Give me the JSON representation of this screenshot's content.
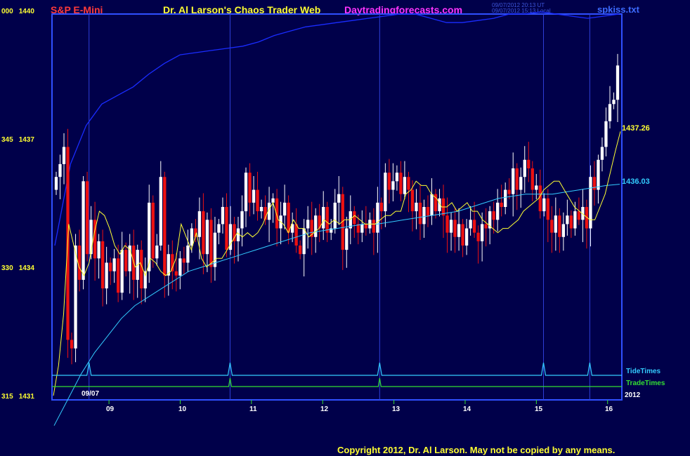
{
  "header": {
    "instrument": "S&P E-Mini",
    "title": "Dr. Al Larson's Chaos Trader Web",
    "site": "Daytradingforecasts.com",
    "file": "spkiss.txt",
    "timestamp_ut": "09/07/2012 20:13 UT",
    "timestamp_local": "09/07/2012 15:13 Local"
  },
  "footer": {
    "copyright": "Copyright 2012, Dr. Al Larson. May not be copied by any means."
  },
  "colors": {
    "background": "#00004a",
    "frame": "#3050ff",
    "up_bar": "#ffffff",
    "down_bar": "#ee1111",
    "fast_ma": "#ffff33",
    "slow_ma": "#33ccff",
    "upper_curve": "#1a2cff",
    "tide_times": "#33ccff",
    "trade_times": "#33dd33",
    "grid": "#2f3fd8"
  },
  "chart_data": {
    "type": "candlestick",
    "title": "S&P E-Mini",
    "ylim": [
      1431,
      1440
    ],
    "y_ticks": [
      {
        "left": "315",
        "value": "1431"
      },
      {
        "left": "330",
        "value": "1434"
      },
      {
        "left": "345",
        "value": "1437"
      },
      {
        "left": "000",
        "value": "1440"
      }
    ],
    "x_ticks": [
      "09",
      "10",
      "11",
      "12",
      "13",
      "14",
      "15",
      "16"
    ],
    "date_label": "09/07",
    "year_label": "2012",
    "xlim_hours": [
      8.2,
      16.2
    ],
    "vertical_time_lines": [
      8.72,
      10.7,
      12.8,
      15.1,
      15.75
    ],
    "last_values": {
      "fast_ma": "1437.26",
      "slow_ma": "1436.03"
    },
    "indicator_labels": {
      "tide": "TideTimes",
      "trade": "TradeTimes"
    },
    "tide_time_spikes": [
      8.72,
      10.7,
      12.8,
      15.1,
      15.75
    ],
    "trade_time_spikes": [
      10.7,
      12.8
    ],
    "close_series": [
      1436.2,
      1436.5,
      1436.9,
      1432.4,
      1432.2,
      1434.6,
      1433.8,
      1436.1,
      1434.4,
      1435.2,
      1434.3,
      1434.7,
      1433.6,
      1434.2,
      1434.0,
      1434.3,
      1433.5,
      1434.5,
      1434.0,
      1434.6,
      1433.8,
      1434.5,
      1433.6,
      1434.0,
      1435.6,
      1434.3,
      1434.6,
      1436.2,
      1433.9,
      1434.4,
      1434.0,
      1433.9,
      1434.3,
      1434.2,
      1434.6,
      1435.0,
      1434.8,
      1435.4,
      1434.4,
      1435.2,
      1434.1,
      1434.9,
      1435.1,
      1435.5,
      1434.5,
      1435.1,
      1434.7,
      1435.0,
      1435.4,
      1436.3,
      1435.6,
      1435.9,
      1435.4,
      1435.5,
      1435.2,
      1435.6,
      1435.7,
      1435.0,
      1435.3,
      1435.6,
      1434.9,
      1435.1,
      1434.6,
      1434.4,
      1435.0,
      1435.2,
      1434.8,
      1435.3,
      1435.0,
      1435.5,
      1434.9,
      1435.0,
      1435.6,
      1435.8,
      1434.5,
      1435.0,
      1435.4,
      1435.1,
      1434.9,
      1435.1,
      1435.0,
      1435.2,
      1434.9,
      1435.6,
      1435.4,
      1436.3,
      1435.9,
      1436.1,
      1436.3,
      1435.8,
      1436.2,
      1435.9,
      1435.4,
      1435.6,
      1435.1,
      1435.5,
      1435.3,
      1435.8,
      1435.4,
      1435.7,
      1435.3,
      1434.9,
      1435.2,
      1434.8,
      1435.1,
      1434.6,
      1435.0,
      1435.2,
      1434.9,
      1434.7,
      1435.1,
      1435.0,
      1435.4,
      1435.2,
      1435.6,
      1435.5,
      1435.9,
      1435.8,
      1436.4,
      1435.9,
      1436.2,
      1436.6,
      1436.4,
      1435.9,
      1436.0,
      1435.4,
      1435.7,
      1435.2,
      1434.9,
      1435.3,
      1434.8,
      1435.1,
      1435.3,
      1435.0,
      1435.4,
      1435.2,
      1435.5,
      1435.0,
      1436.2,
      1435.9,
      1436.6,
      1436.9,
      1437.5,
      1437.9,
      1438.0,
      1438.8
    ],
    "fast_ma_series": [
      1431.1,
      1431.8,
      1433.0,
      1435.1,
      1434.6,
      1434.1,
      1433.9,
      1434.2,
      1434.9,
      1435.4,
      1435.3,
      1435.0,
      1434.6,
      1434.4,
      1434.6,
      1434.5,
      1434.1,
      1434.2,
      1433.9,
      1434.3,
      1434.2,
      1434.0,
      1433.9,
      1434.0,
      1434.3,
      1435.1,
      1434.8,
      1434.5,
      1434.9,
      1434.3,
      1434.1,
      1434.2,
      1434.3,
      1434.3,
      1434.5,
      1434.7,
      1434.9,
      1434.8,
      1434.9,
      1434.8,
      1434.9,
      1435.1,
      1435.4,
      1435.6,
      1435.2,
      1435.1,
      1434.9,
      1435.2,
      1435.0,
      1435.0,
      1434.8,
      1434.9,
      1435.0,
      1435.2,
      1435.1,
      1435.2,
      1435.1,
      1435.2,
      1435.2,
      1435.3,
      1435.2,
      1435.1,
      1435.1,
      1435.1,
      1435.2,
      1435.3,
      1435.3,
      1435.4,
      1435.4,
      1435.8,
      1435.9,
      1436.1,
      1436.0,
      1436.0,
      1435.8,
      1435.7,
      1435.5,
      1435.5,
      1435.6,
      1435.4,
      1435.5,
      1435.6,
      1435.4,
      1435.4,
      1435.2,
      1435.1,
      1435.0,
      1434.9,
      1435.0,
      1435.0,
      1435.1,
      1435.2,
      1435.4,
      1435.5,
      1435.6,
      1435.7,
      1435.9,
      1436.0,
      1436.1,
      1436.1,
      1435.9,
      1435.7,
      1435.5,
      1435.4,
      1435.3,
      1435.2,
      1435.2,
      1435.5,
      1435.8,
      1436.3,
      1436.8,
      1437.26
    ],
    "slow_ma_series": [
      1430.4,
      1431.0,
      1431.6,
      1432.1,
      1432.5,
      1432.9,
      1433.2,
      1433.4,
      1433.6,
      1433.8,
      1434.0,
      1434.1,
      1434.2,
      1434.3,
      1434.4,
      1434.5,
      1434.6,
      1434.7,
      1434.8,
      1434.9,
      1434.95,
      1435.0,
      1435.05,
      1435.1,
      1435.1,
      1435.15,
      1435.2,
      1435.25,
      1435.3,
      1435.35,
      1435.4,
      1435.5,
      1435.6,
      1435.7,
      1435.75,
      1435.8,
      1435.8,
      1435.8,
      1435.85,
      1435.9,
      1435.95,
      1436.0,
      1436.03
    ],
    "upper_curve_series": [
      1434.6,
      1436.5,
      1437.4,
      1437.9,
      1438.1,
      1438.3,
      1438.6,
      1438.85,
      1439.05,
      1439.1,
      1439.15,
      1439.2,
      1439.25,
      1439.35,
      1439.5,
      1439.6,
      1439.7,
      1439.75,
      1439.8,
      1439.85,
      1439.9,
      1439.95,
      1440.0,
      1440.0,
      1439.9,
      1439.8,
      1439.8,
      1439.85,
      1439.9,
      1440.0,
      1440.0,
      1440.05,
      1440.0,
      1439.95,
      1439.9,
      1439.95,
      1440.0
    ]
  }
}
